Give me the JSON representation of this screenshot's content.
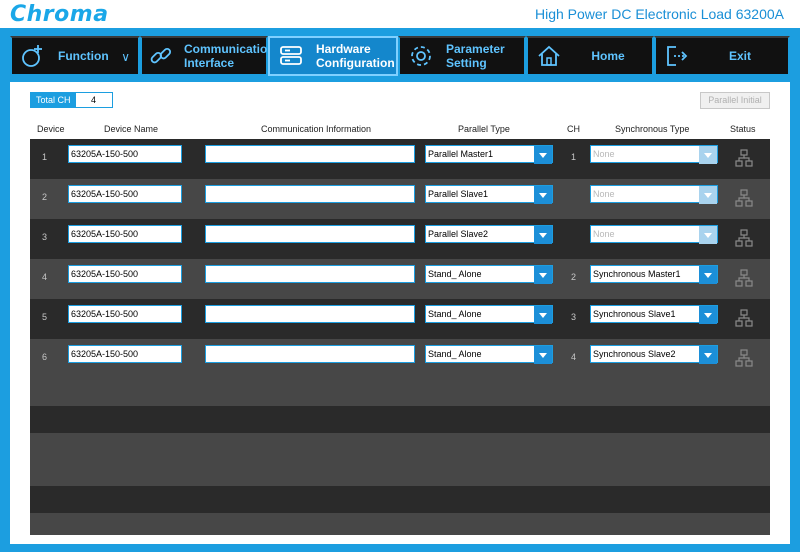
{
  "header": {
    "logo": "Chroma",
    "title": "High Power DC Electronic Load 63200A"
  },
  "nav": [
    {
      "label": "Function",
      "icon": "function-icon",
      "has_chevron": true
    },
    {
      "label": "Communication Interface",
      "line1": "Communication",
      "line2": "Interface",
      "icon": "link-icon"
    },
    {
      "label": "Hardware Configuration",
      "line1": "Hardware",
      "line2": "Configuration",
      "icon": "server-icon",
      "active": true
    },
    {
      "label": "Parameter Setting",
      "line1": "Parameter",
      "line2": "Setting",
      "icon": "gear-icon"
    },
    {
      "label": "Home",
      "icon": "home-icon"
    },
    {
      "label": "Exit",
      "icon": "exit-icon"
    }
  ],
  "total_ch": {
    "label": "Total CH",
    "value": "4"
  },
  "parallel_initial": "Parallel Initial",
  "columns": {
    "device": "Device",
    "device_name": "Device Name",
    "comm_info": "Communication Information",
    "parallel_type": "Parallel Type",
    "ch": "CH",
    "sync_type": "Synchronous Type",
    "status": "Status"
  },
  "rows": [
    {
      "device": "1",
      "name": "63205A-150-500",
      "comm": "",
      "parallel": "Parallel Master1",
      "ch": "1",
      "sync": "None",
      "sync_disabled": true
    },
    {
      "device": "2",
      "name": "63205A-150-500",
      "comm": "",
      "parallel": "Parallel Slave1",
      "ch": "",
      "sync": "None",
      "sync_disabled": true
    },
    {
      "device": "3",
      "name": "63205A-150-500",
      "comm": "",
      "parallel": "Parallel Slave2",
      "ch": "",
      "sync": "None",
      "sync_disabled": true
    },
    {
      "device": "4",
      "name": "63205A-150-500",
      "comm": "",
      "parallel": "Stand_ Alone",
      "ch": "2",
      "sync": "Synchronous Master1",
      "sync_disabled": false
    },
    {
      "device": "5",
      "name": "63205A-150-500",
      "comm": "",
      "parallel": "Stand_ Alone",
      "ch": "3",
      "sync": "Synchronous Slave1",
      "sync_disabled": false
    },
    {
      "device": "6",
      "name": "63205A-150-500",
      "comm": "",
      "parallel": "Stand_ Alone",
      "ch": "4",
      "sync": "Synchronous Slave2",
      "sync_disabled": false
    }
  ],
  "colors": {
    "brand_blue": "#1c9ee0",
    "row_dark": "#2a2a2a",
    "row_light": "#474747",
    "nav_active": "#1487cc"
  }
}
